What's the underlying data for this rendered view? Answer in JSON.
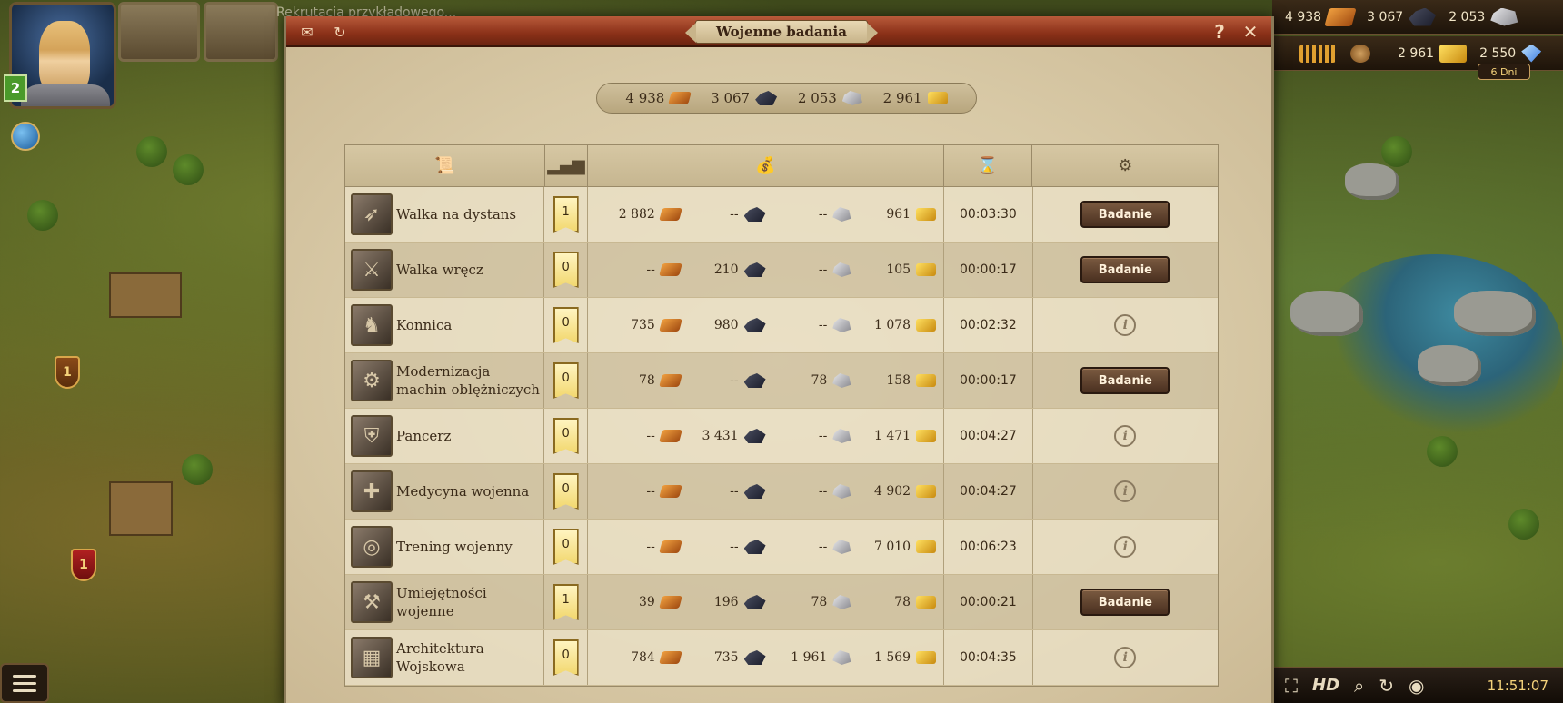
{
  "quest": {
    "text": "Rekrutacja przykładowego..."
  },
  "player": {
    "level": "2"
  },
  "resources_top": {
    "wood": "4 938",
    "stone": "3 067",
    "silver": "2 053",
    "gold": "2 961",
    "gems": "2 550",
    "days": "6 Dni"
  },
  "map": {
    "shield_1": "1",
    "shield_2": "1"
  },
  "bottom": {
    "hd_label": "HD",
    "clock": "11:51:07"
  },
  "dialog": {
    "title": "Wojenne badania",
    "stock": {
      "wood": "4 938",
      "ore": "3 067",
      "stone": "2 053",
      "gold": "2 961"
    },
    "research_label": "Badanie",
    "rows": [
      {
        "name": "Walka na dystans",
        "level": "1",
        "wood": "2 882",
        "ore": "--",
        "stone": "--",
        "gold": "961",
        "time": "00:03:30",
        "action": "button"
      },
      {
        "name": "Walka wręcz",
        "level": "0",
        "wood": "--",
        "ore": "210",
        "stone": "--",
        "gold": "105",
        "time": "00:00:17",
        "action": "button"
      },
      {
        "name": "Konnica",
        "level": "0",
        "wood": "735",
        "ore": "980",
        "stone": "--",
        "gold": "1 078",
        "time": "00:02:32",
        "action": "info"
      },
      {
        "name": "Modernizacja machin oblężniczych",
        "level": "0",
        "wood": "78",
        "ore": "--",
        "stone": "78",
        "gold": "158",
        "time": "00:00:17",
        "action": "button"
      },
      {
        "name": "Pancerz",
        "level": "0",
        "wood": "--",
        "ore": "3 431",
        "stone": "--",
        "gold": "1 471",
        "time": "00:04:27",
        "action": "info"
      },
      {
        "name": "Medycyna wojenna",
        "level": "0",
        "wood": "--",
        "ore": "--",
        "stone": "--",
        "gold": "4 902",
        "time": "00:04:27",
        "action": "info"
      },
      {
        "name": "Trening wojenny",
        "level": "0",
        "wood": "--",
        "ore": "--",
        "stone": "--",
        "gold": "7 010",
        "time": "00:06:23",
        "action": "info"
      },
      {
        "name": "Umiejętności wojenne",
        "level": "1",
        "wood": "39",
        "ore": "196",
        "stone": "78",
        "gold": "78",
        "time": "00:00:21",
        "action": "button"
      },
      {
        "name": "Architektura Wojskowa",
        "level": "0",
        "wood": "784",
        "ore": "735",
        "stone": "1 961",
        "gold": "1 569",
        "time": "00:04:35",
        "action": "info"
      }
    ]
  },
  "icons": {
    "col_name": "scroll-icon",
    "col_level": "signal-bars-icon",
    "col_cost": "money-bag-icon",
    "col_time": "hourglass-icon",
    "col_action": "gears-icon"
  }
}
